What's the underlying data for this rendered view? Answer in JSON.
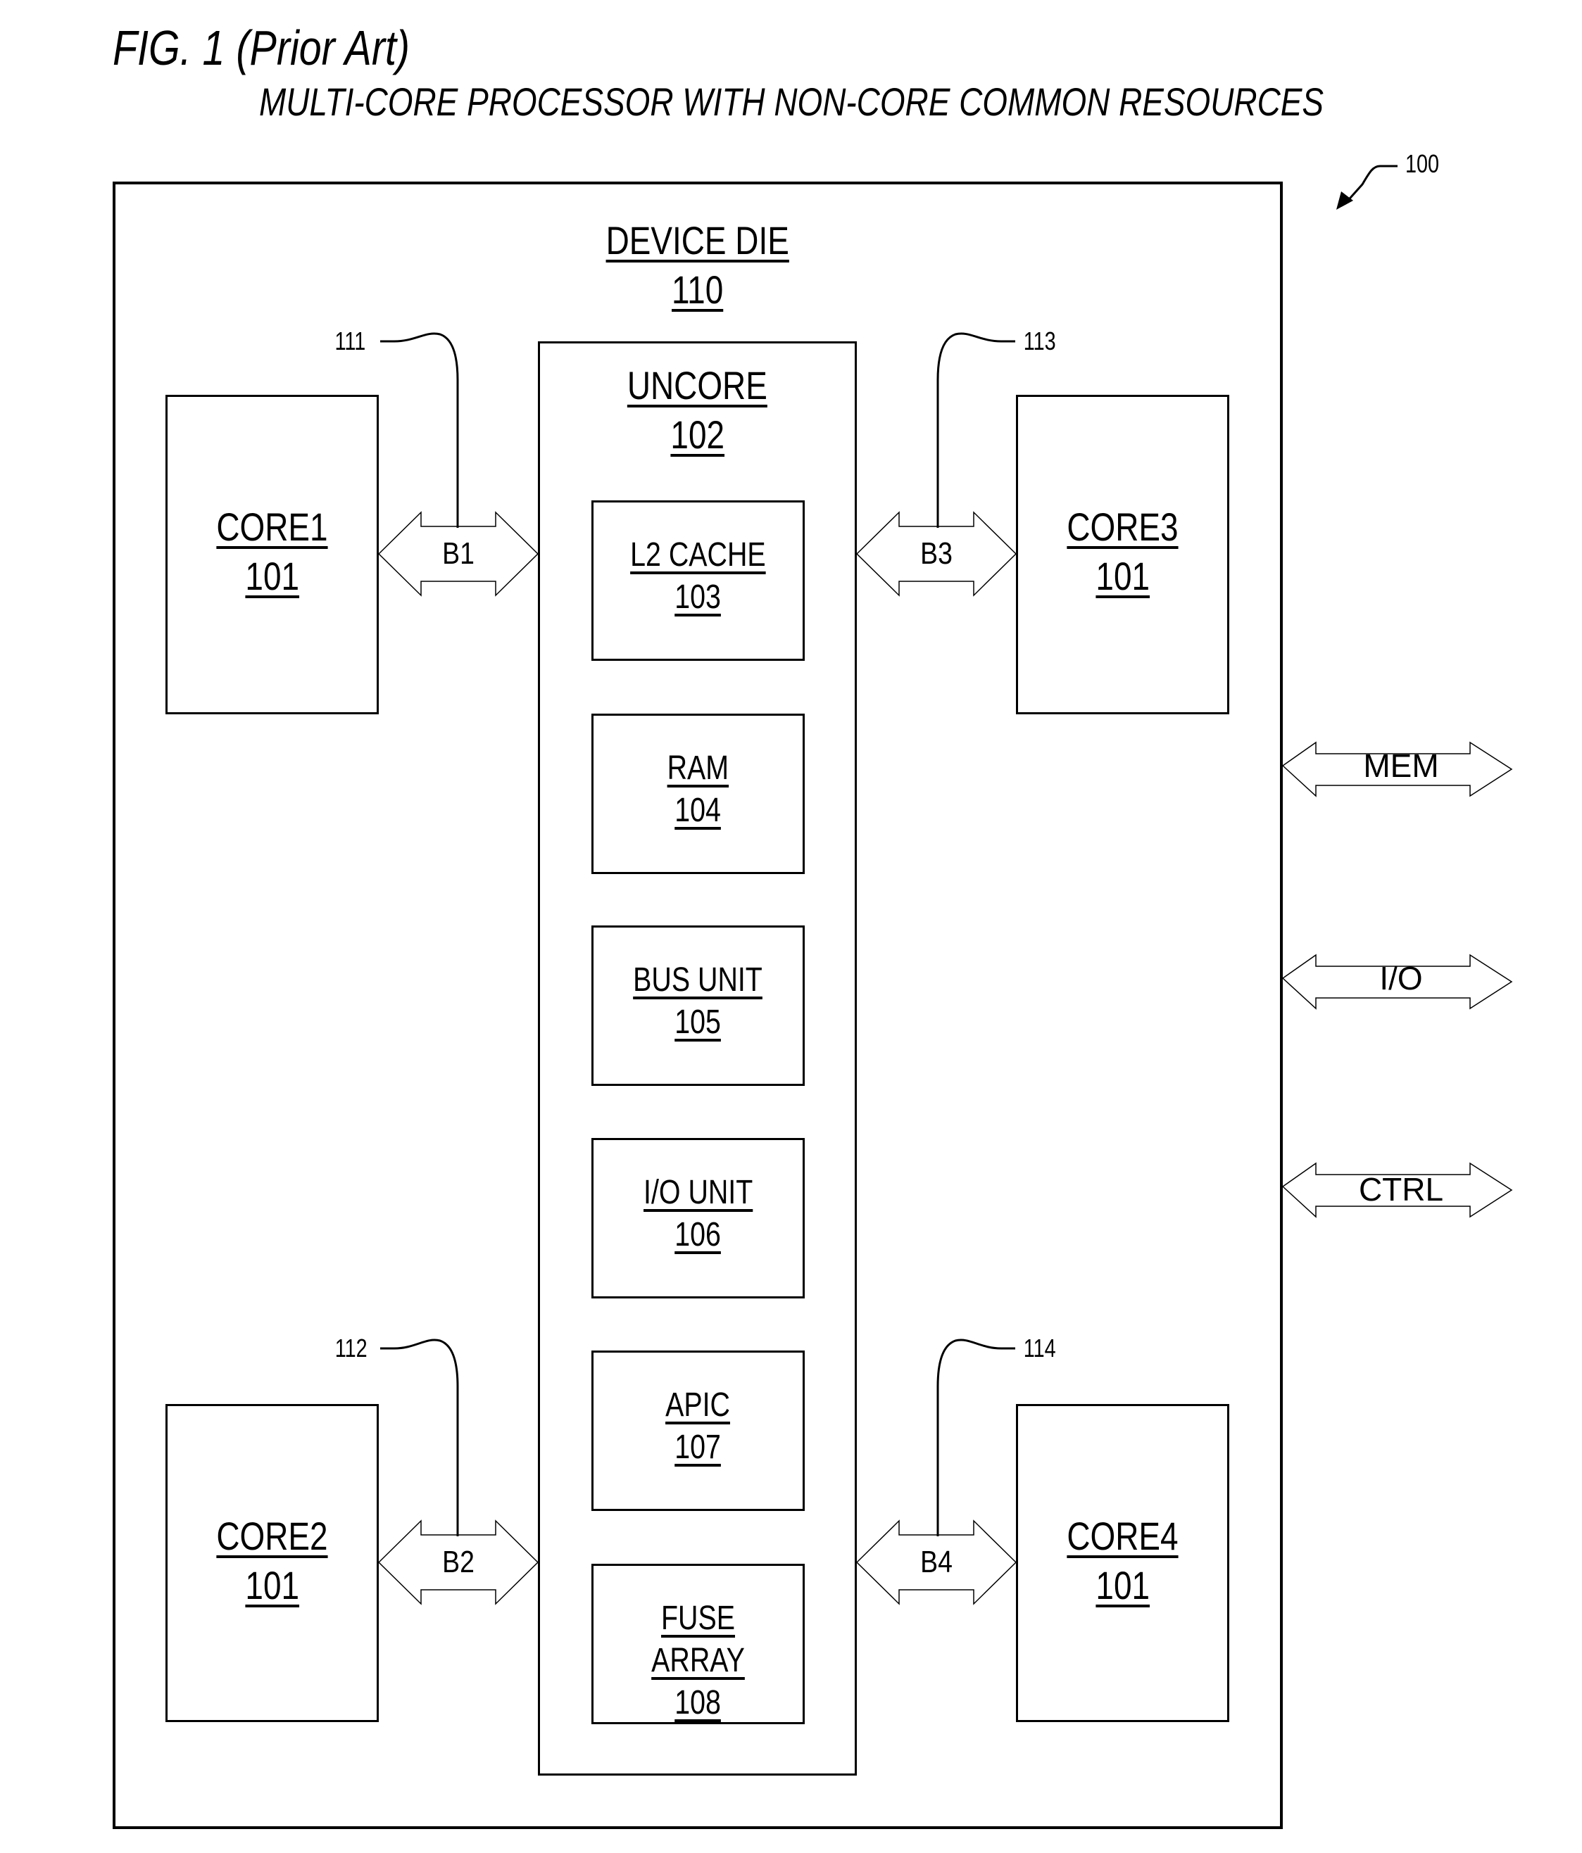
{
  "figure": {
    "title": "FIG. 1 (Prior Art)",
    "subtitle": "MULTI-CORE PROCESSOR WITH NON-CORE COMMON RESOURCES",
    "ref_number": "100"
  },
  "device_die": {
    "name": "DEVICE DIE",
    "ref": "110"
  },
  "uncore": {
    "name": "UNCORE",
    "ref": "102",
    "blocks": [
      {
        "name": "L2 CACHE",
        "ref": "103"
      },
      {
        "name": "RAM",
        "ref": "104"
      },
      {
        "name": "BUS UNIT",
        "ref": "105"
      },
      {
        "name": "I/O UNIT",
        "ref": "106"
      },
      {
        "name": "APIC",
        "ref": "107"
      },
      {
        "name": "FUSE ARRAY",
        "ref": "108"
      }
    ]
  },
  "cores": [
    {
      "name": "CORE1",
      "ref": "101"
    },
    {
      "name": "CORE2",
      "ref": "101"
    },
    {
      "name": "CORE3",
      "ref": "101"
    },
    {
      "name": "CORE4",
      "ref": "101"
    }
  ],
  "buses": [
    {
      "label": "B1",
      "ref": "111"
    },
    {
      "label": "B2",
      "ref": "112"
    },
    {
      "label": "B3",
      "ref": "113"
    },
    {
      "label": "B4",
      "ref": "114"
    }
  ],
  "external_interfaces": [
    {
      "label": "MEM"
    },
    {
      "label": "I/O"
    },
    {
      "label": "CTRL"
    }
  ]
}
